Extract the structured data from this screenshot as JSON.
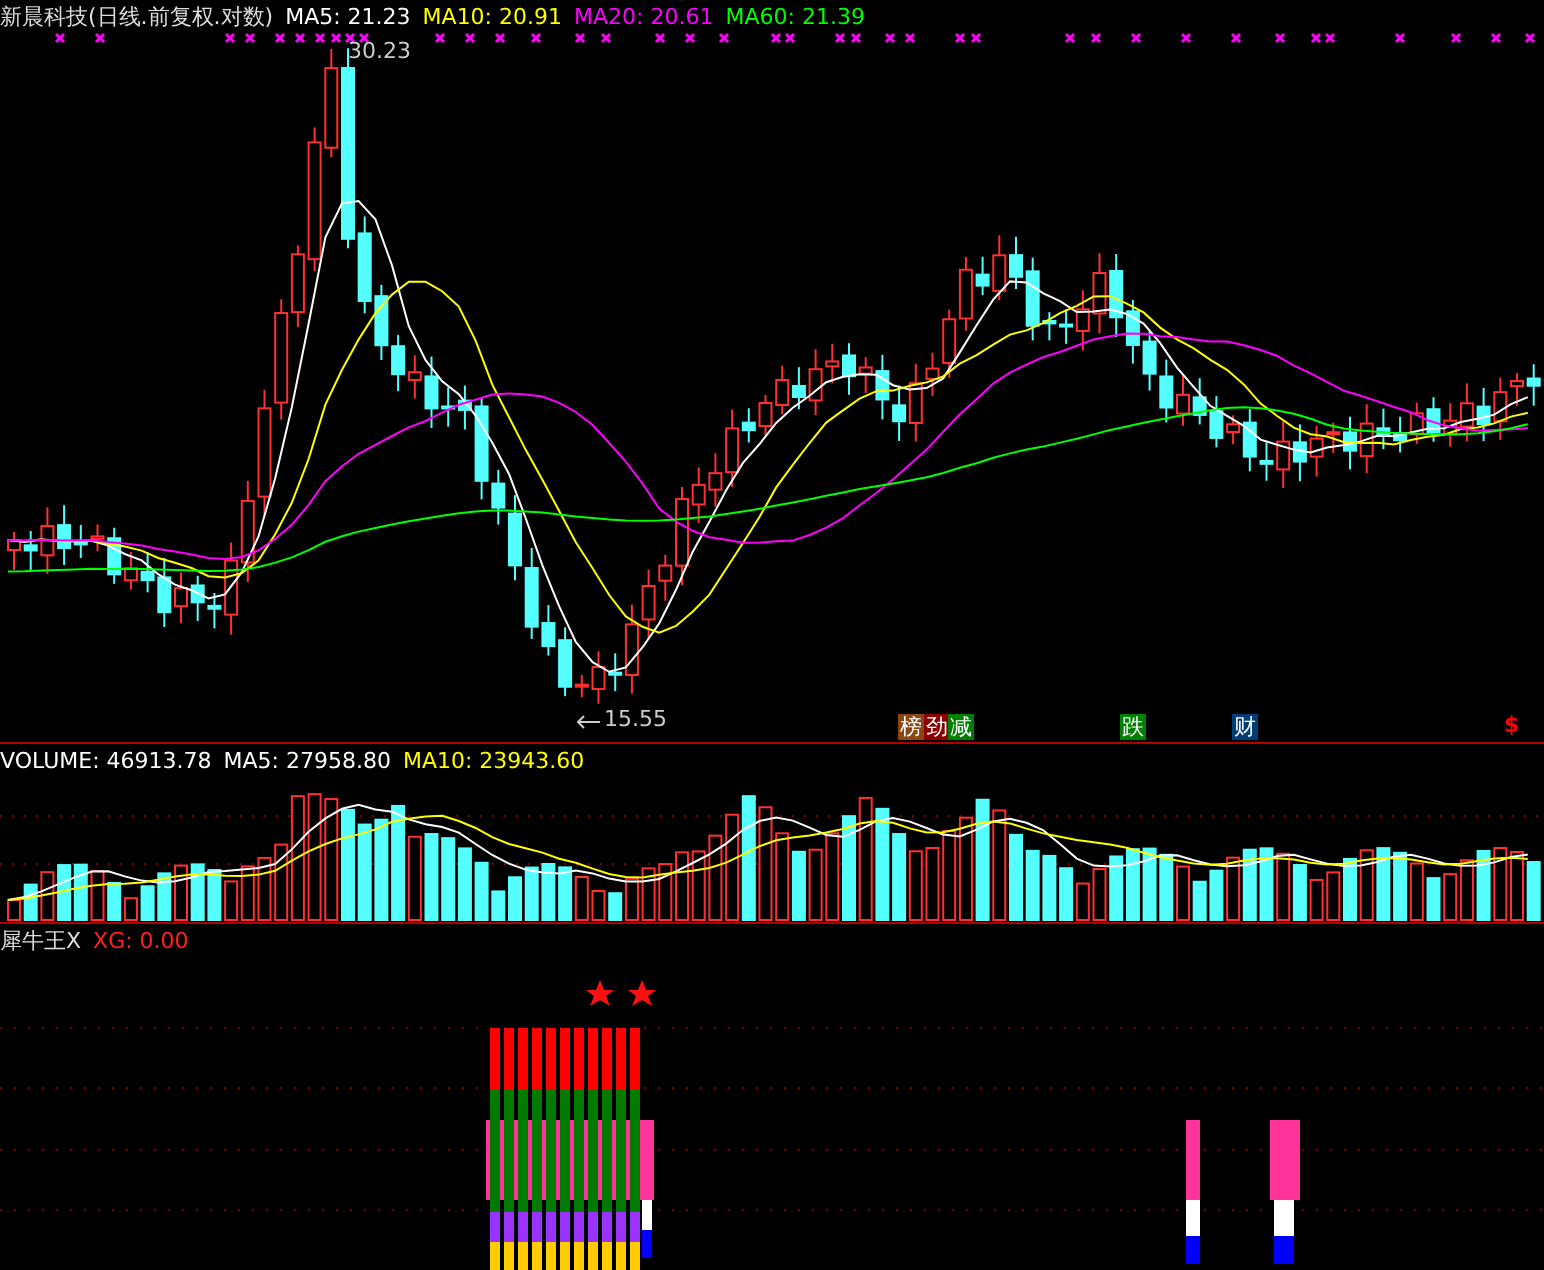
{
  "price_header": {
    "title": "新晨科技(日线.前复权.对数)",
    "indicators": [
      {
        "label": "MA5: 21.23",
        "color": "#ffffff"
      },
      {
        "label": "MA10: 20.91",
        "color": "#ffff00"
      },
      {
        "label": "MA20: 20.61",
        "color": "#ff00ff"
      },
      {
        "label": "MA60: 21.39",
        "color": "#00ff00"
      }
    ]
  },
  "price_chart": {
    "high_label": "30.23",
    "low_label": "15.55",
    "badges": [
      {
        "text": "榜",
        "color": "#8b4513"
      },
      {
        "text": "劲",
        "color": "#8b0000"
      },
      {
        "text": "减",
        "color": "#008000"
      },
      {
        "text": "跌",
        "color": "#008000"
      },
      {
        "text": "财",
        "color": "#003c78"
      }
    ],
    "marker": "$"
  },
  "volume_header": {
    "indicators": [
      {
        "label": "VOLUME: 46913.78",
        "color": "#ffffff"
      },
      {
        "label": "MA5: 27958.80",
        "color": "#ffffff"
      },
      {
        "label": "MA10: 23943.60",
        "color": "#ffff00"
      }
    ]
  },
  "signal_header": {
    "name": "犀牛王X",
    "indicators": [
      {
        "label": "XG: 0.00",
        "color": "#ff2020"
      }
    ]
  }
}
